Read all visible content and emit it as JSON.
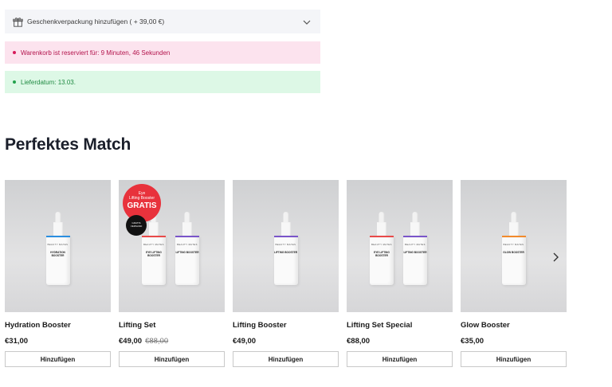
{
  "gift": {
    "label": "Geschenkverpackung hinzufügen ( + 39,00 €)",
    "icon": "gift-icon"
  },
  "notices": {
    "reserve": "Warenkorb ist reserviert für: 9 Minuten, 46 Sekunden",
    "delivery": "Lieferdatum: 13.03."
  },
  "section": {
    "title": "Perfektes Match"
  },
  "products": [
    {
      "name": "Hydration Booster",
      "price": "€31,00",
      "old_price": "",
      "button": "Hinzufügen",
      "bottles": [
        {
          "label": "HYDRATION BOOSTER",
          "accent": "#2a8ee0"
        }
      ]
    },
    {
      "name": "Lifting Set",
      "price": "€49,00",
      "old_price": "€88,00",
      "button": "Hinzufügen",
      "badge": {
        "line1": "Eye",
        "line2": "Lifting Booster",
        "big": "GRATIS"
      },
      "badge2": "GRATIS VERSAND",
      "bottles": [
        {
          "label": "EYE LIFTING BOOSTER",
          "accent": "#e84a4a"
        },
        {
          "label": "LIFTING BOOSTER",
          "accent": "#7a55c9"
        }
      ]
    },
    {
      "name": "Lifting Booster",
      "price": "€49,00",
      "old_price": "",
      "button": "Hinzufügen",
      "bottles": [
        {
          "label": "LIFTING BOOSTER",
          "accent": "#7a55c9"
        }
      ]
    },
    {
      "name": "Lifting Set Special",
      "price": "€88,00",
      "old_price": "",
      "button": "Hinzufügen",
      "bottles": [
        {
          "label": "EYE LIFTING BOOSTER",
          "accent": "#e84a4a"
        },
        {
          "label": "LIFTING BOOSTER",
          "accent": "#7a55c9"
        }
      ]
    },
    {
      "name": "Glow Booster",
      "price": "€35,00",
      "old_price": "",
      "button": "Hinzufügen",
      "bottles": [
        {
          "label": "GLOW BOOSTER",
          "accent": "#f28a2c"
        }
      ]
    }
  ],
  "brand_text": "BEAUTY MATES",
  "icons": {
    "chevron": "chevron-down-icon",
    "next": "chevron-right-icon"
  }
}
